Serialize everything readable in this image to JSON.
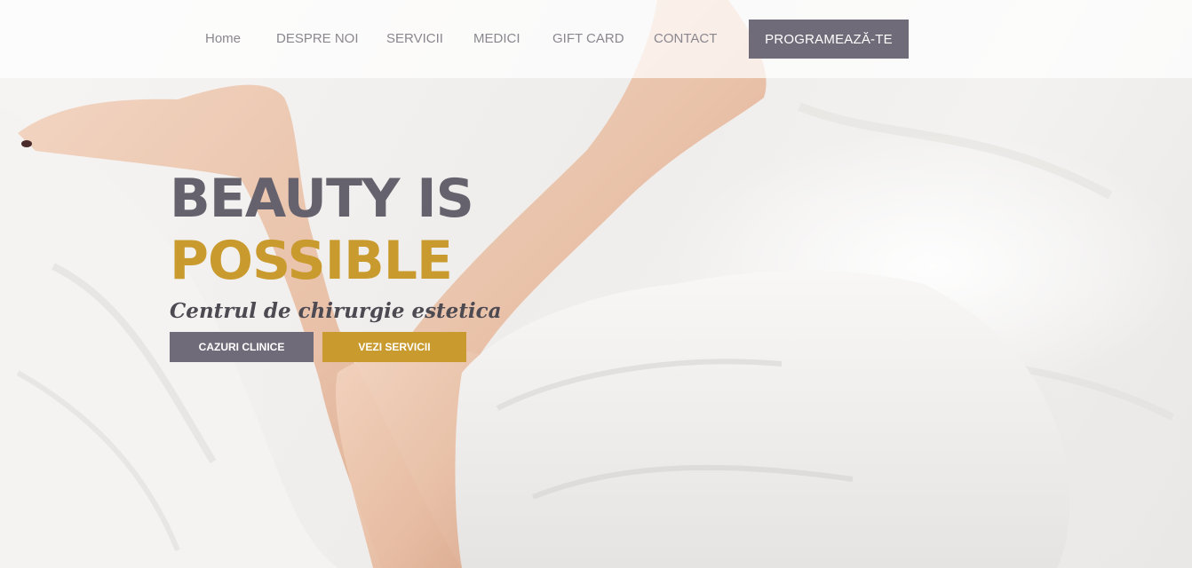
{
  "nav": {
    "items": [
      {
        "label": "Home"
      },
      {
        "label": "DESPRE NOI"
      },
      {
        "label": "SERVICII"
      },
      {
        "label": "MEDICI"
      },
      {
        "label": "GIFT CARD"
      },
      {
        "label": "CONTACT"
      }
    ],
    "cta_label": "PROGRAMEAZĂ-TE"
  },
  "hero": {
    "headline_line1": "BEAUTY IS",
    "headline_line2": "POSSIBLE",
    "subtitle": "Centrul de chirurgie estetica",
    "primary_button": "CAZURI CLINICE",
    "secondary_button": "VEZI SERVICII"
  },
  "colors": {
    "accent_gray": "#6f6b78",
    "accent_gold": "#c99a2e",
    "nav_text": "#8a878f"
  }
}
